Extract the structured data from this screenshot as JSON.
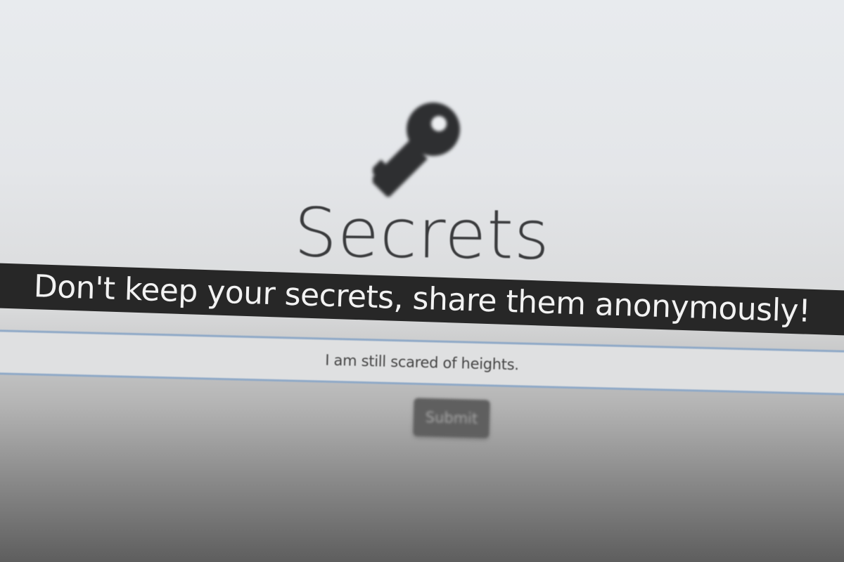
{
  "header": {
    "icon": "key-icon",
    "title": "Secrets",
    "tagline": "Don't keep your secrets, share them anonymously!"
  },
  "form": {
    "secret_value": "I am still scared of heights.",
    "submit_label": "Submit"
  },
  "colors": {
    "banner_background": "#272727",
    "banner_text": "#f2f2f2",
    "input_border": "#8fa9c7",
    "button_background": "#5f5f5f",
    "icon_color": "#2e2f31"
  }
}
